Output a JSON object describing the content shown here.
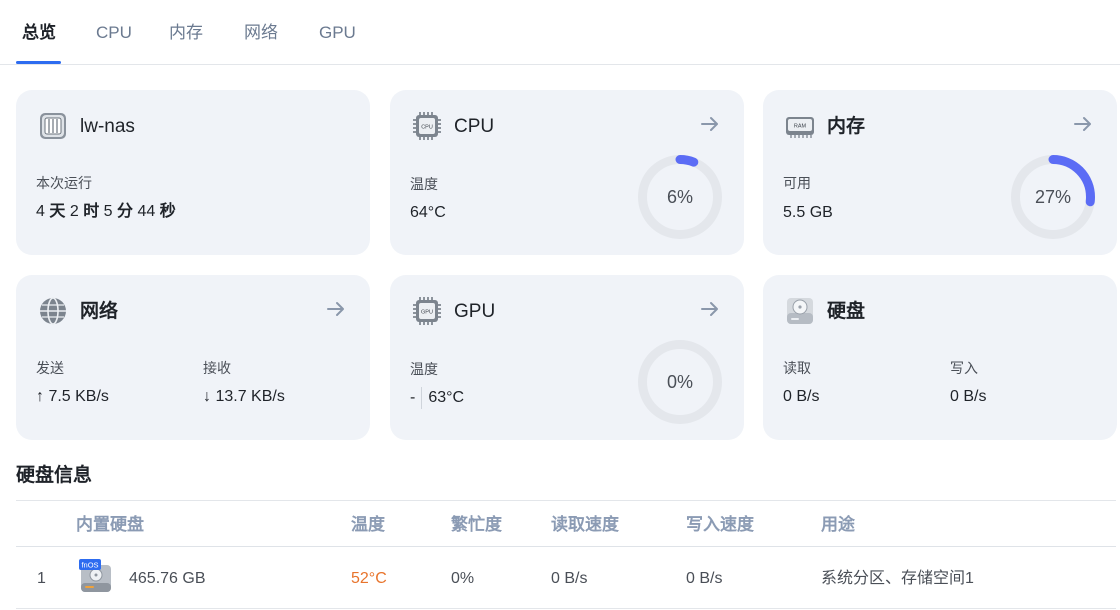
{
  "tabs": [
    "总览",
    "CPU",
    "内存",
    "网络",
    "GPU"
  ],
  "active_tab": "总览",
  "cards": {
    "system": {
      "title": "lw-nas",
      "uptime_label": "本次运行",
      "uptime": {
        "d": "4",
        "d_unit": "天",
        "h": "2",
        "h_unit": "时",
        "m": "5",
        "m_unit": "分",
        "s": "44",
        "s_unit": "秒"
      },
      "icon": "nas-device-icon"
    },
    "cpu": {
      "title": "CPU",
      "temp_label": "温度",
      "temp": "64°C",
      "usage_text": "6%",
      "usage": 6,
      "icon_text": "CPU"
    },
    "memory": {
      "title": "内存",
      "available_label": "可用",
      "available": "5.5 GB",
      "usage_text": "27%",
      "usage": 27,
      "icon_text": "RAM"
    },
    "network": {
      "title": "网络",
      "send_label": "发送",
      "send": "↑ 7.5 KB/s",
      "recv_label": "接收",
      "recv": "↓ 13.7 KB/s",
      "icon": "globe-icon"
    },
    "gpu": {
      "title": "GPU",
      "temp_label": "温度",
      "temp_a": "-",
      "temp_b": "63°C",
      "usage_text": "0%",
      "usage": 0,
      "icon_text": "GPU"
    },
    "disk": {
      "title": "硬盘",
      "read_label": "读取",
      "read": "0 B/s",
      "write_label": "写入",
      "write": "0 B/s",
      "icon": "hard-disk-icon"
    }
  },
  "disk_section": {
    "title": "硬盘信息",
    "columns": [
      "内置硬盘",
      "温度",
      "繁忙度",
      "读取速度",
      "写入速度",
      "用途"
    ],
    "rows": [
      {
        "index": "1",
        "badge": "fnOS",
        "size": "465.76 GB",
        "temp": "52°C",
        "busy": "0%",
        "read": "0 B/s",
        "write": "0 B/s",
        "usage": "系统分区、存储空间1"
      }
    ]
  },
  "colors": {
    "accent": "#2d6cf0",
    "gauge": "#5b6cf5",
    "gauge_track": "#e4e7ec",
    "card_bg": "#f0f3f8",
    "temp_warn": "#e8742c"
  }
}
